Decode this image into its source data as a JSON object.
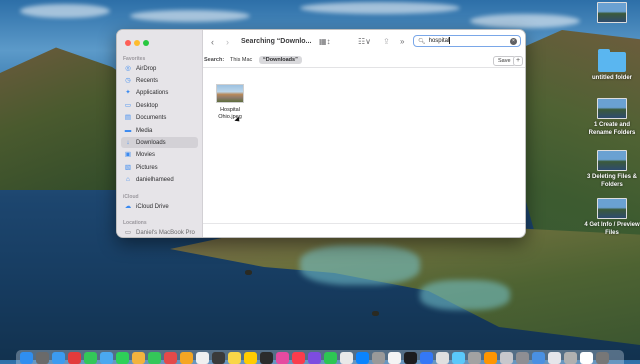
{
  "finder": {
    "title": "Searching “Downlo...",
    "sidebar": {
      "favorites_header": "Favorites",
      "icloud_header": "iCloud",
      "locations_header": "Locations",
      "favorites": [
        {
          "label": "AirDrop",
          "icon": "airdrop-icon",
          "glyph": "◎"
        },
        {
          "label": "Recents",
          "icon": "clock-icon",
          "glyph": "◷"
        },
        {
          "label": "Applications",
          "icon": "applications-icon",
          "glyph": "✦"
        },
        {
          "label": "Desktop",
          "icon": "desktop-icon",
          "glyph": "▭"
        },
        {
          "label": "Documents",
          "icon": "document-icon",
          "glyph": "▤"
        },
        {
          "label": "Media",
          "icon": "folder-icon",
          "glyph": "▬"
        },
        {
          "label": "Downloads",
          "icon": "download-icon",
          "glyph": "↓",
          "selected": true
        },
        {
          "label": "Movies",
          "icon": "film-icon",
          "glyph": "▣"
        },
        {
          "label": "Pictures",
          "icon": "photo-icon",
          "glyph": "▧"
        },
        {
          "label": "danielhameed",
          "icon": "home-icon",
          "glyph": "⌂"
        }
      ],
      "icloud": [
        {
          "label": "iCloud Drive",
          "icon": "cloud-icon",
          "glyph": "☁"
        }
      ],
      "locations": [
        {
          "label": "Daniel's MacBook Pro",
          "icon": "laptop-icon",
          "glyph": "▭"
        }
      ]
    },
    "search": {
      "query": "hospital",
      "clear_glyph": "×"
    },
    "scope": {
      "label": "Search:",
      "this_mac": "This Mac",
      "selected": "“Downloads”",
      "save_label": "Save",
      "plus_label": "+"
    },
    "results": [
      {
        "name_line1": "Hospital",
        "name_line2": "Ohio.jpeg"
      }
    ]
  },
  "desktop_items": [
    {
      "label": "",
      "kind": "thumb"
    },
    {
      "label": "untitled folder",
      "kind": "folder"
    },
    {
      "label": "1 Create and Rename Folders",
      "kind": "thumb"
    },
    {
      "label": "3 Deleting Files & Folders",
      "kind": "thumb"
    },
    {
      "label": "4 Get Info / Preview Files",
      "kind": "thumb"
    }
  ],
  "dock_colors": [
    "#2f8ef0",
    "#6a6a6a",
    "#3c9bf0",
    "#e33b3b",
    "#33c758",
    "#4aa8f0",
    "#2ed158",
    "#f2b33d",
    "#34c759",
    "#e44a4a",
    "#f5a623",
    "#f0f0f0",
    "#3a3a3a",
    "#f9d648",
    "#ffcc00",
    "#2b2b2b",
    "#e64aa0",
    "#fa3c4c",
    "#7d4ce0",
    "#2dc653",
    "#e8e8e8",
    "#0a84ff",
    "#999999",
    "#f4f4f4",
    "#1c1c1e",
    "#3478f6",
    "#dfdfdf",
    "#5ac8fa",
    "#a2a2a2",
    "#ff9500",
    "#c7c7cc",
    "#8e8e93",
    "#4a90e2",
    "#e5e5ea",
    "#b0b0b0",
    "#ffffff",
    "#777777"
  ]
}
